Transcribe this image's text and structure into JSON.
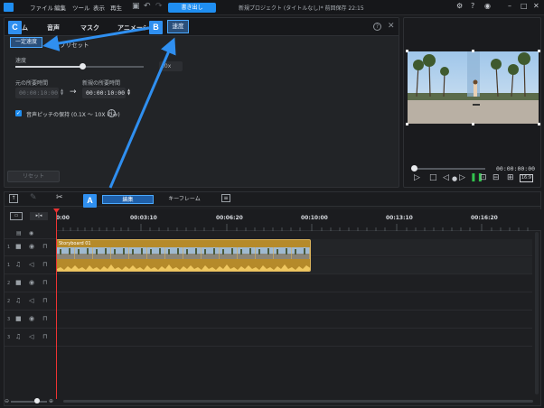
{
  "app": {
    "title": "新規プロジェクト (タイトルなし)* 前回保存 22:15",
    "menu": [
      "ファイル",
      "編集",
      "ツール",
      "表示",
      "再生"
    ],
    "export_label": "書き出し"
  },
  "panel": {
    "tabs": [
      "ム",
      "音声",
      "マスク",
      "アニメーション"
    ],
    "tab_speed": "速度",
    "subtabs": {
      "constant": "一定速度",
      "preset": "プリセット"
    },
    "speed_label": "速度",
    "speed_value": ".0x",
    "orig_duration_label": "元の所要時間",
    "orig_duration_value": "00:00:10:00",
    "new_duration_label": "新規の所要時間",
    "new_duration_value": "00:00:10:00",
    "pitch_label": "音声ピッチの保持 (0.1X 〜 10X のみ)",
    "reset_label": "リセット"
  },
  "preview": {
    "timecode": "00:00:00:00",
    "aspect": "16:9"
  },
  "timeline": {
    "edit_tab": "編集",
    "keyframe_tab": "キーフレーム",
    "ruler": [
      "0:00",
      "00:03:10",
      "00:06:20",
      "00:10:00",
      "00:13:10",
      "00:16:20"
    ],
    "clip_label": "Storyboard 01",
    "tracks": [
      "1",
      "1",
      "2",
      "2",
      "3",
      "3"
    ]
  },
  "annotations": {
    "a": "A",
    "b": "B",
    "c": "C"
  },
  "colors": {
    "accent": "#1f8ef1",
    "clip": "#b58a2a",
    "annotation": "#2f8ff0"
  }
}
